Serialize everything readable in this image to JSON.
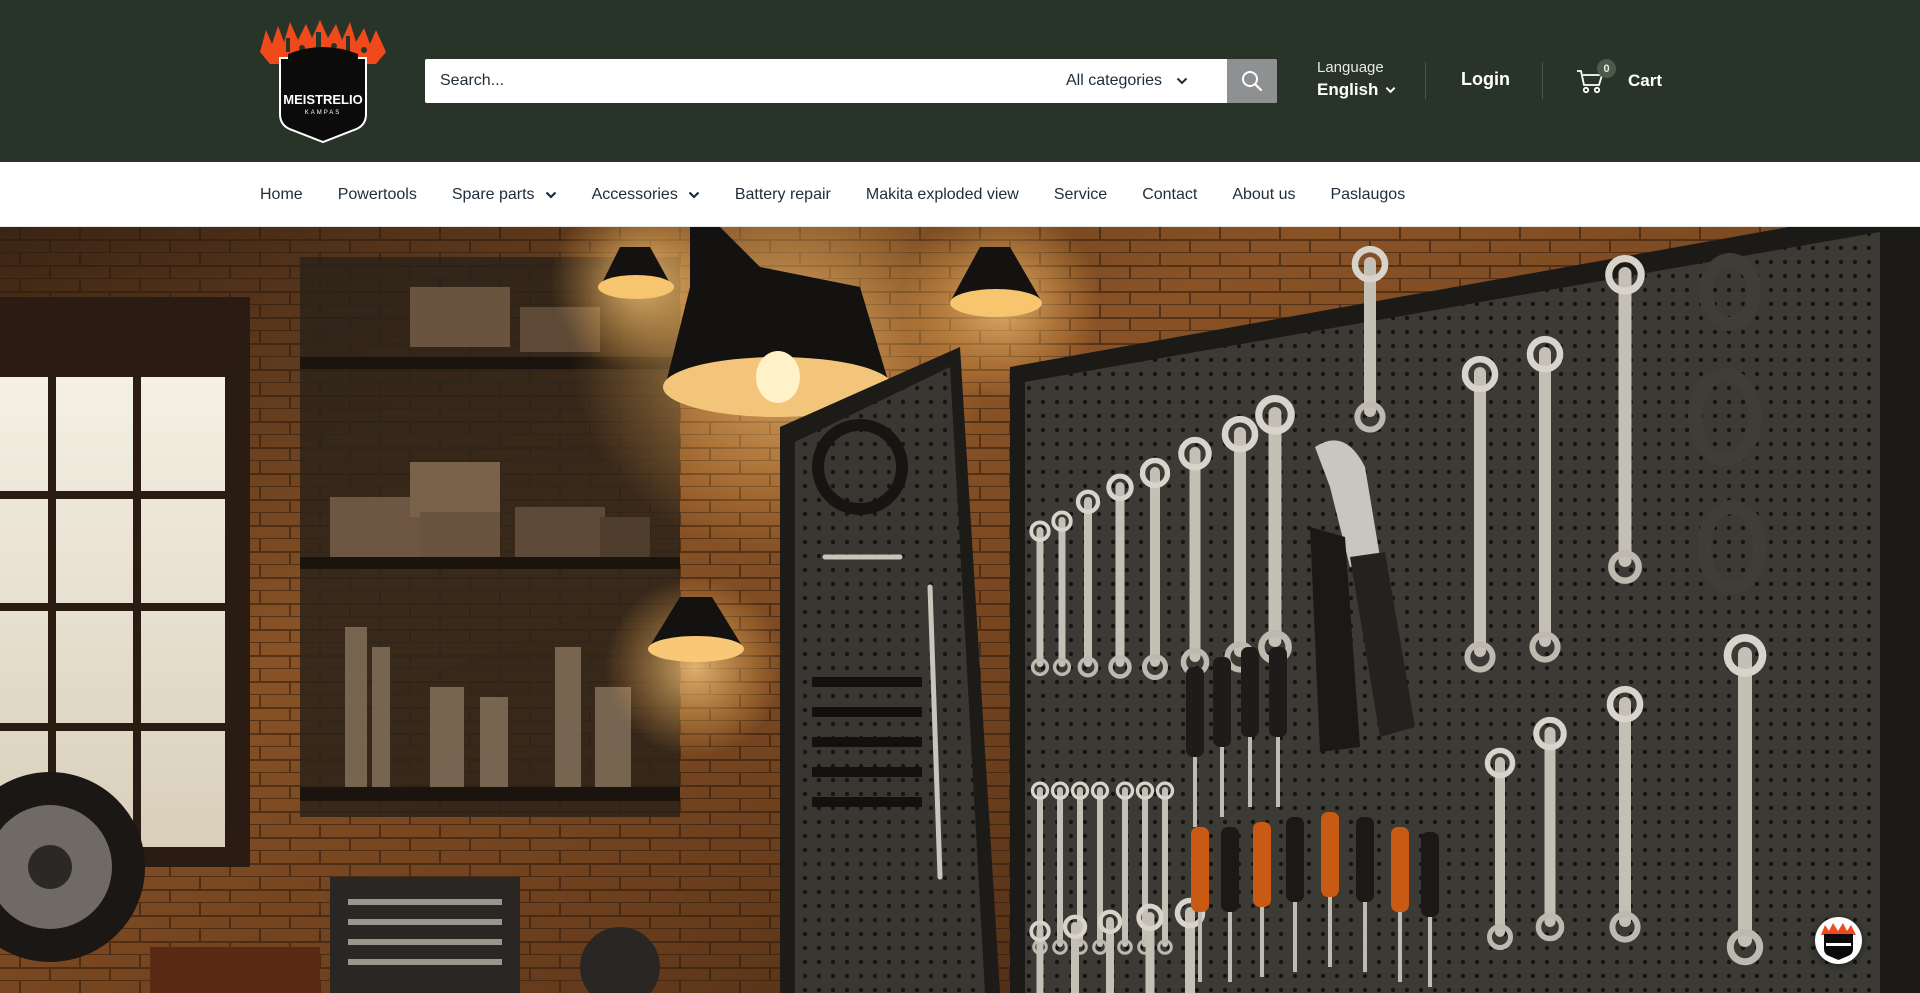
{
  "brand": {
    "logo_text": "MEISTRELIO",
    "logo_subtext": "KAMPAS"
  },
  "search": {
    "placeholder": "Search...",
    "category_selected": "All categories"
  },
  "language": {
    "caption": "Language",
    "selected": "English"
  },
  "account": {
    "login_label": "Login"
  },
  "cart": {
    "label": "Cart",
    "count": "0"
  },
  "nav": {
    "items": [
      {
        "label": "Home",
        "has_dropdown": false
      },
      {
        "label": "Powertools",
        "has_dropdown": false
      },
      {
        "label": "Spare parts",
        "has_dropdown": true
      },
      {
        "label": "Accessories",
        "has_dropdown": true
      },
      {
        "label": "Battery repair",
        "has_dropdown": false
      },
      {
        "label": "Makita exploded view",
        "has_dropdown": false
      },
      {
        "label": "Service",
        "has_dropdown": false
      },
      {
        "label": "Contact",
        "has_dropdown": false
      },
      {
        "label": "About us",
        "has_dropdown": false
      },
      {
        "label": "Paslaugos",
        "has_dropdown": false
      }
    ]
  },
  "hero": {
    "scene": "workshop-tool-wall-illustration"
  },
  "colors": {
    "header_bg": "#283427",
    "logo_orange": "#f04a1c",
    "search_button_bg": "#8e9092",
    "nav_text": "#1e2d3b"
  },
  "icons": {
    "search": "search-icon",
    "cart": "cart-icon",
    "chevron": "chevron-down-icon",
    "chat": "chat-badge-icon"
  }
}
